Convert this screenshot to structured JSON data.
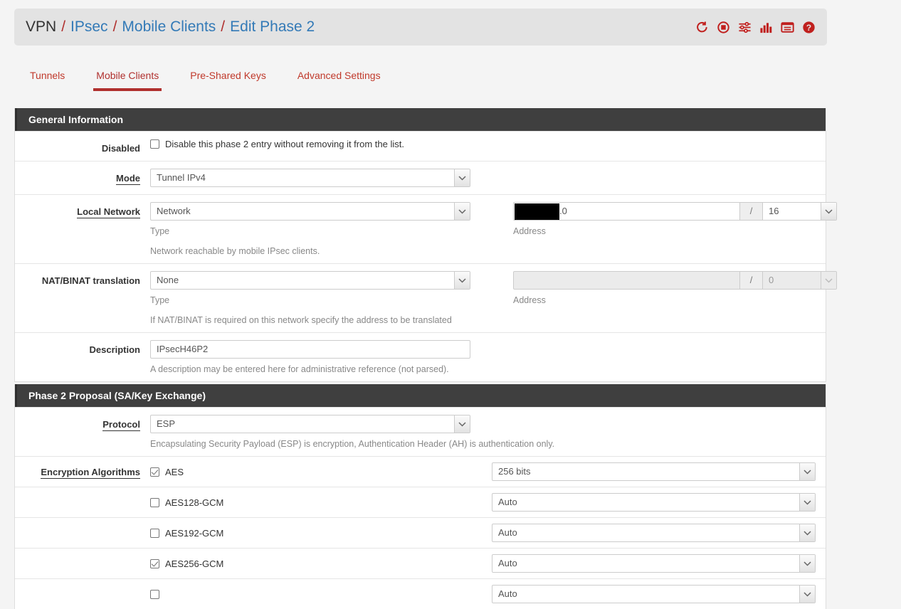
{
  "breadcrumb": {
    "root": "VPN",
    "sep": "/",
    "items": [
      "IPsec",
      "Mobile Clients",
      "Edit Phase 2"
    ],
    "icons": [
      {
        "name": "refresh-icon",
        "title": "Refresh"
      },
      {
        "name": "stop-icon",
        "title": "Stop"
      },
      {
        "name": "sliders-icon",
        "title": "Settings"
      },
      {
        "name": "bar-chart-icon",
        "title": "Status"
      },
      {
        "name": "log-icon",
        "title": "Logs"
      },
      {
        "name": "help-icon",
        "title": "Help"
      }
    ],
    "icon_color": "#c0201e",
    "link_color": "#337ab7"
  },
  "tabs": [
    {
      "label": "Tunnels",
      "active": false
    },
    {
      "label": "Mobile Clients",
      "active": true
    },
    {
      "label": "Pre-Shared Keys",
      "active": false
    },
    {
      "label": "Advanced Settings",
      "active": false
    }
  ],
  "general": {
    "heading": "General Information",
    "disabled": {
      "label": "Disabled",
      "checkbox_label": "Disable this phase 2 entry without removing it from the list.",
      "checked": false
    },
    "mode": {
      "label": "Mode",
      "value": "Tunnel IPv4"
    },
    "local_network": {
      "label": "Local Network",
      "type_value": "Network",
      "type_caption": "Type",
      "address_caption": "Address",
      "address_value": ".0",
      "address_redacted": true,
      "slash": "/",
      "cidr_value": "16",
      "note": "Network reachable by mobile IPsec clients."
    },
    "nat_binat": {
      "label": "NAT/BINAT translation",
      "type_value": "None",
      "type_caption": "Type",
      "address_caption": "Address",
      "address_value": "",
      "slash": "/",
      "cidr_value": "0",
      "disabled": true,
      "note": "If NAT/BINAT is required on this network specify the address to be translated"
    },
    "description": {
      "label": "Description",
      "value": "IPsecH46P2",
      "note": "A description may be entered here for administrative reference (not parsed)."
    }
  },
  "phase2": {
    "heading": "Phase 2 Proposal (SA/Key Exchange)",
    "protocol": {
      "label": "Protocol",
      "value": "ESP",
      "note": "Encapsulating Security Payload (ESP) is encryption, Authentication Header (AH) is authentication only."
    },
    "encryption": {
      "label": "Encryption Algorithms",
      "algorithms": [
        {
          "name": "AES",
          "checked": true,
          "keylen": "256 bits"
        },
        {
          "name": "AES128-GCM",
          "checked": false,
          "keylen": "Auto"
        },
        {
          "name": "AES192-GCM",
          "checked": false,
          "keylen": "Auto"
        },
        {
          "name": "AES256-GCM",
          "checked": true,
          "keylen": "Auto"
        },
        {
          "name": "",
          "checked": false,
          "keylen": "Auto"
        }
      ]
    }
  }
}
